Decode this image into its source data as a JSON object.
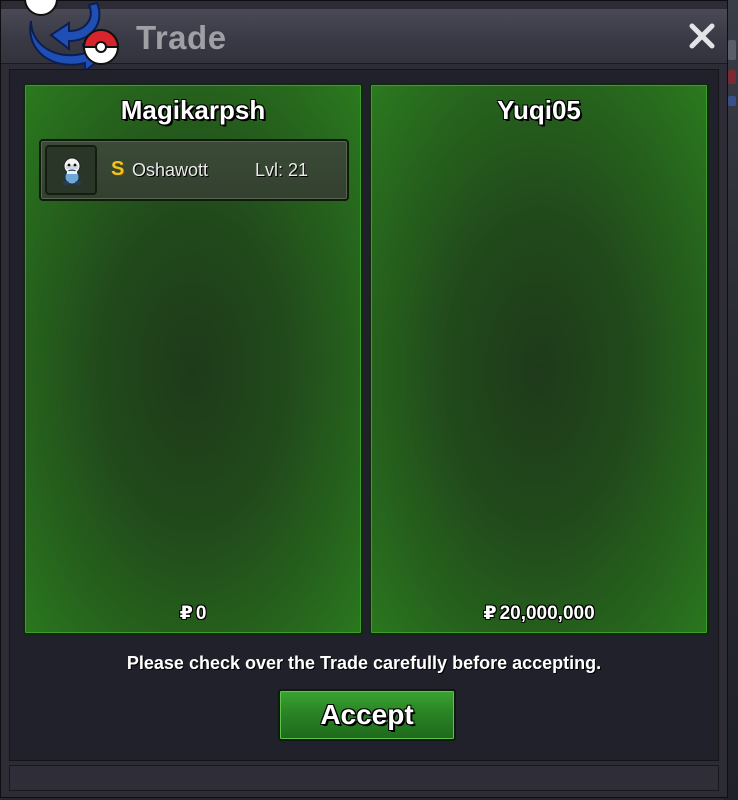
{
  "window": {
    "title": "Trade"
  },
  "left_panel": {
    "player_name": "Magikarpsh",
    "pokemon": [
      {
        "badge": "S",
        "name": "Oshawott",
        "level_text": "Lvl: 21",
        "sprite_icon": "oshawott-sprite-icon"
      }
    ],
    "money_symbol": "₽",
    "money": "0"
  },
  "right_panel": {
    "player_name": "Yuqi05",
    "pokemon": [],
    "money_symbol": "₽",
    "money": "20,000,000"
  },
  "notice": "Please check over the Trade carefully before accepting.",
  "accept_button": {
    "label": "Accept"
  },
  "icons": {
    "title_logo": "trade-arrows-pokeball-icon",
    "close": "close-icon",
    "badge": "gold-s-badge-icon"
  },
  "colors": {
    "panel_green": "#2b7a1f",
    "button_green": "#2a8425",
    "badge_gold": "#f3c21d",
    "title_text": "#9f9fa6"
  }
}
